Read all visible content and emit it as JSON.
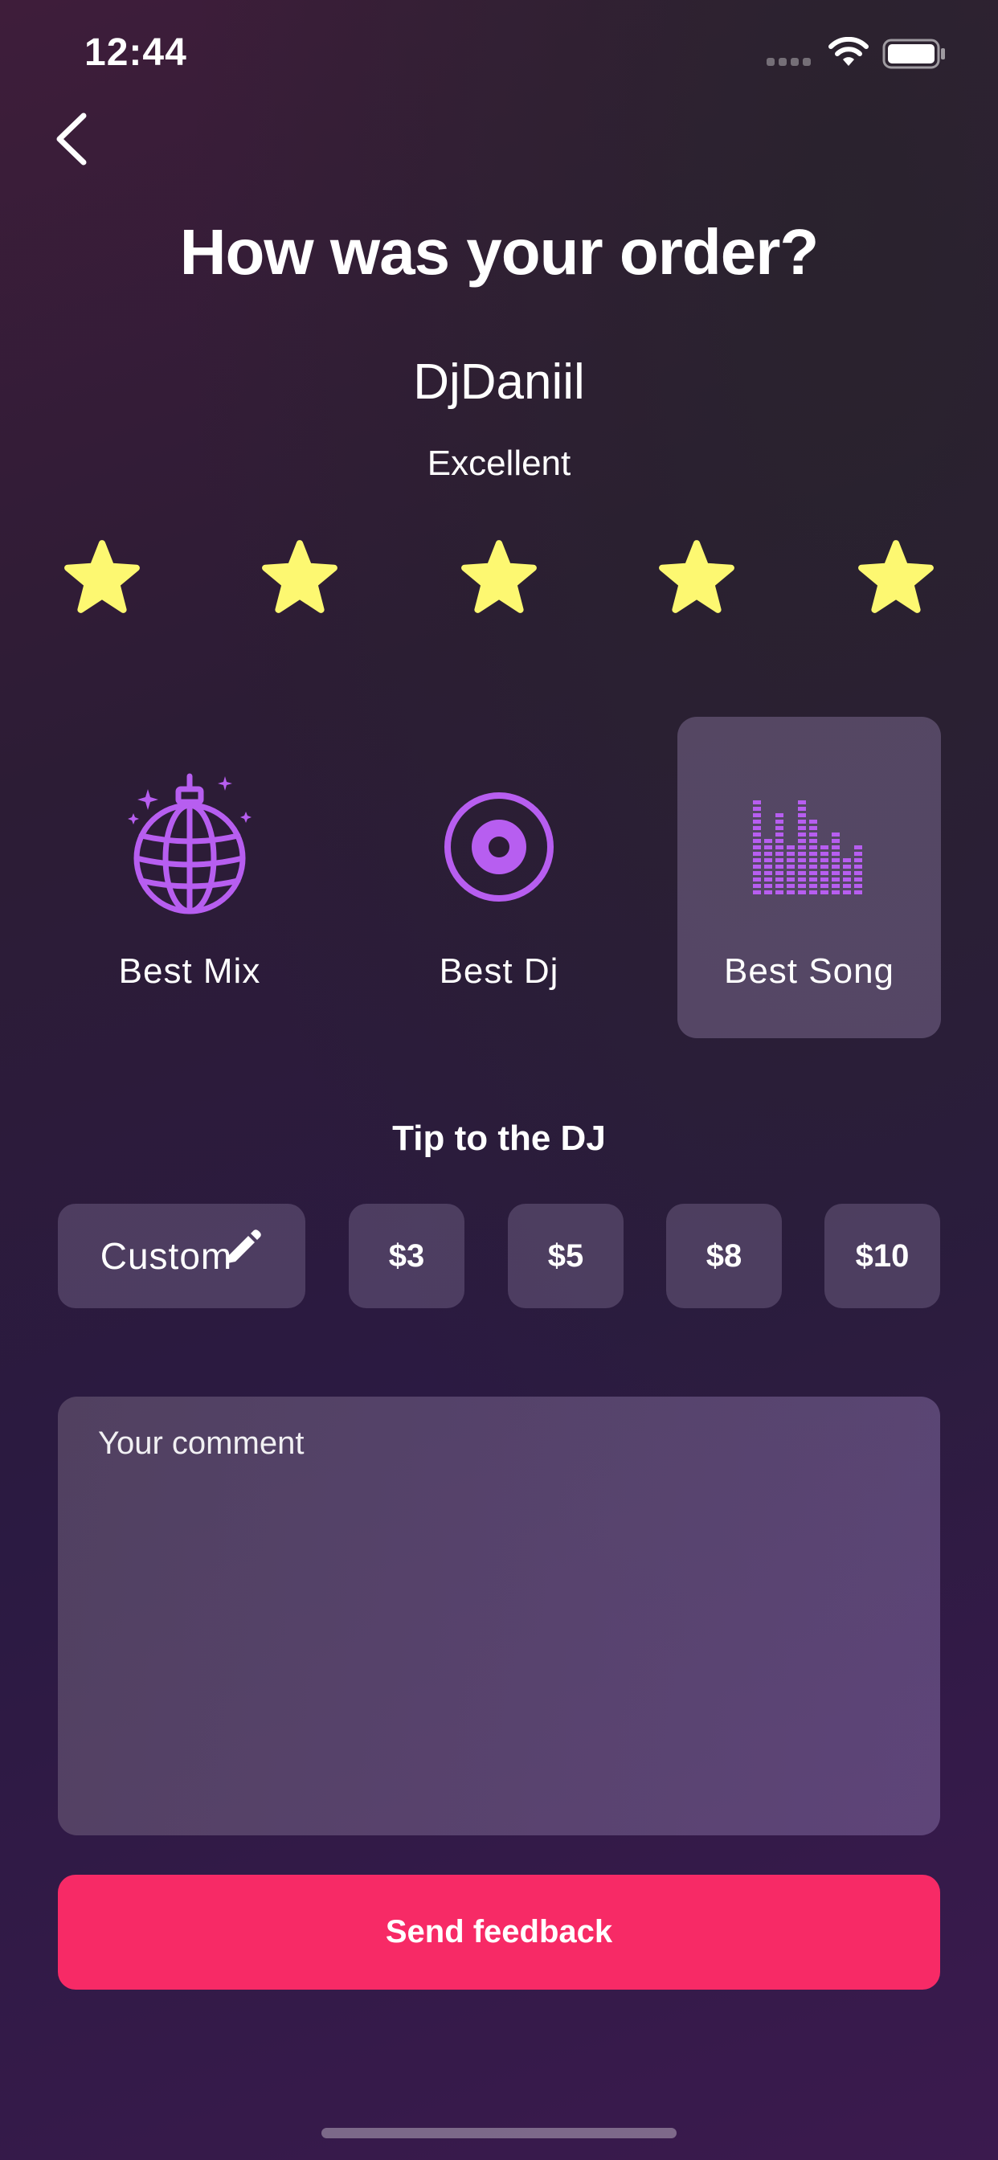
{
  "status_bar": {
    "time": "12:44",
    "icons": [
      "signal-icon",
      "wifi-icon",
      "battery-icon"
    ]
  },
  "header": {
    "back_icon": "chevron-left-icon",
    "title": "How was your order?"
  },
  "dj": {
    "name": "DjDaniil"
  },
  "rating": {
    "label": "Excellent",
    "value": 5,
    "max": 5,
    "star_color": "#fdf871"
  },
  "categories": {
    "selected_index": 2,
    "items": [
      {
        "label": "Best Mix",
        "icon": "disco-ball-icon"
      },
      {
        "label": "Best Dj",
        "icon": "vinyl-record-icon"
      },
      {
        "label": "Best Song",
        "icon": "equalizer-icon"
      }
    ],
    "icon_color": "#b75ef0"
  },
  "tip": {
    "title": "Tip to the DJ",
    "custom_label": "Custom",
    "custom_icon": "pencil-icon",
    "amounts": [
      "$3",
      "$5",
      "$8",
      "$10"
    ]
  },
  "comment": {
    "placeholder": "Your comment",
    "value": ""
  },
  "actions": {
    "send_label": "Send feedback",
    "send_color": "#f72a66"
  }
}
